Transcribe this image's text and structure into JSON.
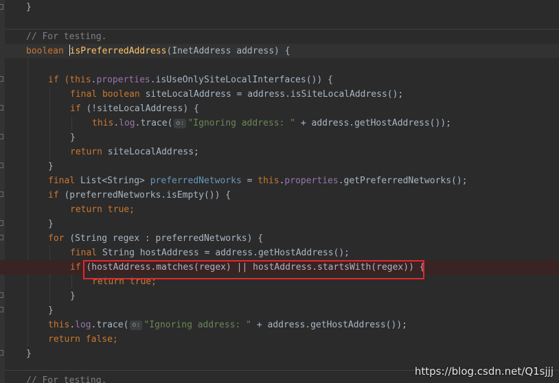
{
  "editor": {
    "lines": {
      "l0": {
        "close": "}"
      },
      "l1": {
        "comment": "// For testing."
      },
      "l2": {
        "kw": "boolean ",
        "name": "isPreferredAddress",
        "rest": "(InetAddress address) {"
      },
      "l4": {
        "kw_if": "if (",
        "kw_this": "this",
        "dot": ".",
        "fld": "properties",
        "rest": ".isUseOnlySiteLocalInterfaces()) {"
      },
      "l5": {
        "kw": "final boolean ",
        "rest": "siteLocalAddress = address.isSiteLocalAddress();"
      },
      "l6": {
        "kw": "if ",
        "rest": "(!siteLocalAddress) {"
      },
      "l7": {
        "kw_this": "this",
        "dot": ".",
        "fld": "log",
        "mid": ".trace(",
        "hint": "o:",
        "str": "\"Ignoring address: \"",
        "rest": " + address.getHostAddress());"
      },
      "l8": {
        "close": "}"
      },
      "l9": {
        "kw": "return ",
        "rest": "siteLocalAddress;"
      },
      "l10": {
        "close": "}"
      },
      "l11": {
        "kw": "final ",
        "type": "List<String> ",
        "var": "preferredNetworks",
        "mid": " = ",
        "kw_this": "this",
        "dot": ".",
        "fld": "properties",
        "rest": ".getPreferredNetworks();"
      },
      "l12": {
        "kw": "if ",
        "rest": "(preferredNetworks.isEmpty()) {"
      },
      "l13": {
        "kw": "return true;"
      },
      "l14": {
        "close": "}"
      },
      "l15": {
        "kw": "for ",
        "rest": "(String regex : preferredNetworks) {"
      },
      "l16": {
        "kw": "final ",
        "rest": "String hostAddress = address.getHostAddress();"
      },
      "l17": {
        "kw": "if ",
        "rest": "(hostAddress.matches(regex) || hostAddress.startsWith(regex)) {"
      },
      "l18": {
        "kw": "return true;"
      },
      "l19": {
        "close": "}"
      },
      "l20": {
        "close": "}"
      },
      "l21": {
        "kw_this": "this",
        "dot": ".",
        "fld": "log",
        "mid": ".trace(",
        "hint": "o:",
        "str": "\"Ignoring address: \"",
        "rest": " + address.getHostAddress());"
      },
      "l22": {
        "kw": "return false;"
      },
      "l23": {
        "close": "}"
      },
      "l25": {
        "comment": "// For testing."
      }
    }
  },
  "watermark": "https://blog.csdn.net/Q1sjjj"
}
